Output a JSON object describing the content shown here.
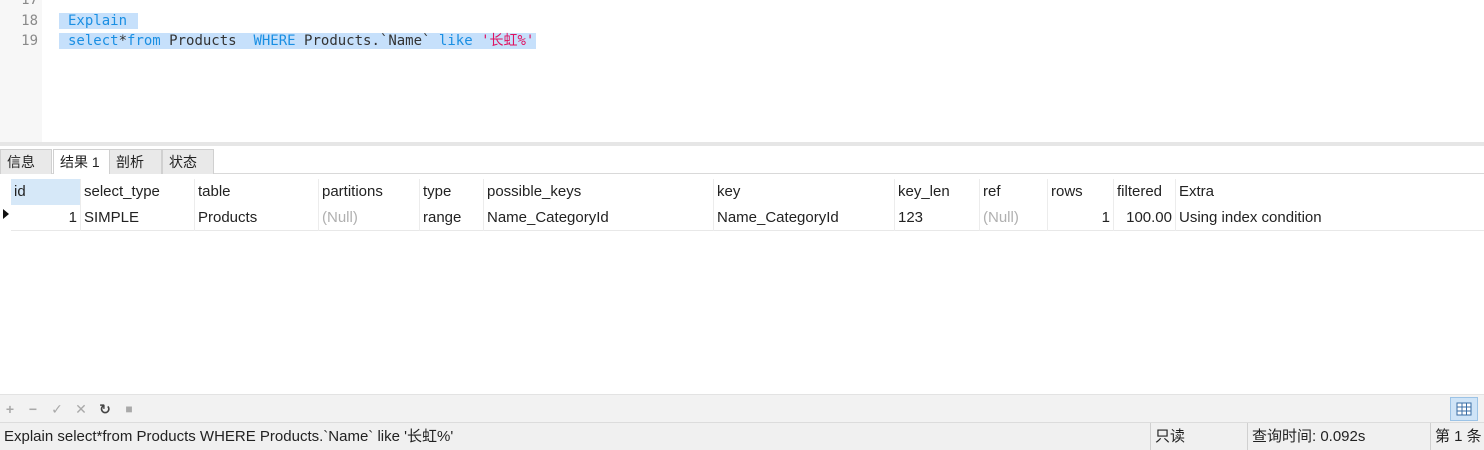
{
  "editor": {
    "line_numbers": [
      "17",
      "18",
      "19"
    ],
    "lines": [
      {
        "explain_kw": "Explain"
      },
      {
        "select_kw": "select",
        "star": "*",
        "from_kw": "from",
        "table": " Products  ",
        "where_kw": "WHERE",
        "column": " Products.`Name` ",
        "like_kw": "like",
        "string": "'长虹%'"
      }
    ]
  },
  "tabs": [
    {
      "label": "信息"
    },
    {
      "label": "结果 1",
      "active": true
    },
    {
      "label": "剖析"
    },
    {
      "label": "状态"
    }
  ],
  "grid": {
    "columns": [
      "id",
      "select_type",
      "table",
      "partitions",
      "type",
      "possible_keys",
      "key",
      "key_len",
      "ref",
      "rows",
      "filtered",
      "Extra"
    ],
    "rows": [
      {
        "id": "1",
        "select_type": "SIMPLE",
        "table": "Products",
        "partitions": "(Null)",
        "type": "range",
        "possible_keys": "Name_CategoryId",
        "key": "Name_CategoryId",
        "key_len": "123",
        "ref": "(Null)",
        "rows": "1",
        "filtered": "100.00",
        "Extra": "Using index condition"
      }
    ]
  },
  "toolbar": {
    "add": "+",
    "delete": "−",
    "apply": "✓",
    "cancel": "✕",
    "refresh": "↻",
    "stop": "■"
  },
  "statusbar": {
    "query": "Explain  select*from Products  WHERE Products.`Name` like '长虹%'",
    "mode": "只读",
    "query_time": "查询时间: 0.092s",
    "record": "第 1 条"
  },
  "colors": {
    "keyword": "#1a8fe3",
    "string": "#e0115f",
    "selection": "#c6e0fb",
    "null_text": "#b0b0b0"
  }
}
